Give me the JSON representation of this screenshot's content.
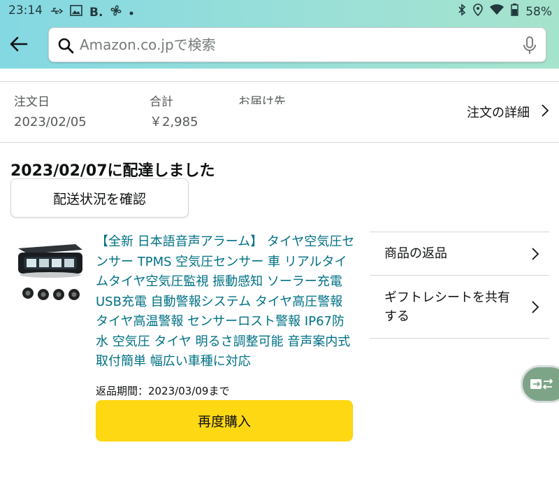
{
  "status_bar": {
    "time": "23:14",
    "left_icons": [
      "usb-icon",
      "image-icon",
      "b-app-icon",
      "fan-icon",
      "dot-icon"
    ],
    "b_letter": "B.",
    "right_icons": [
      "bluetooth-icon",
      "location-icon",
      "wifi-icon",
      "battery-icon"
    ],
    "battery": "58%"
  },
  "header": {
    "search_placeholder": "Amazon.co.jpで検索",
    "theme_color": "#8fdcdc"
  },
  "order": {
    "date_label": "注文日",
    "date_value": "2023/02/05",
    "total_label": "合計",
    "total_value": "￥2,985",
    "ship_to_label": "お届け先",
    "details_link": "注文の詳細"
  },
  "shipment": {
    "status_title": "2023/02/07に配達しました",
    "track_button": "配送状況を確認"
  },
  "product": {
    "title": "【全新 日本語音声アラーム】 タイヤ空気圧センサー TPMS 空気圧センサー 車 リアルタイムタイヤ空気圧監視 振動感知 ソーラー充電 USB充電 自動警報システム タイヤ高圧警報 タイヤ高温警報 センサーロスト警報 IP67防水 空気圧 タイヤ 明るさ調整可能 音声案内式 取付簡単 幅広い車種に対応",
    "return_period": "返品期間：2023/03/09まで",
    "rebuy_button": "再度購入",
    "link_color": "#007185",
    "button_color": "#ffd814"
  },
  "options": [
    {
      "label": "商品の返品"
    },
    {
      "label": "ギフトレシートを共有する"
    }
  ]
}
